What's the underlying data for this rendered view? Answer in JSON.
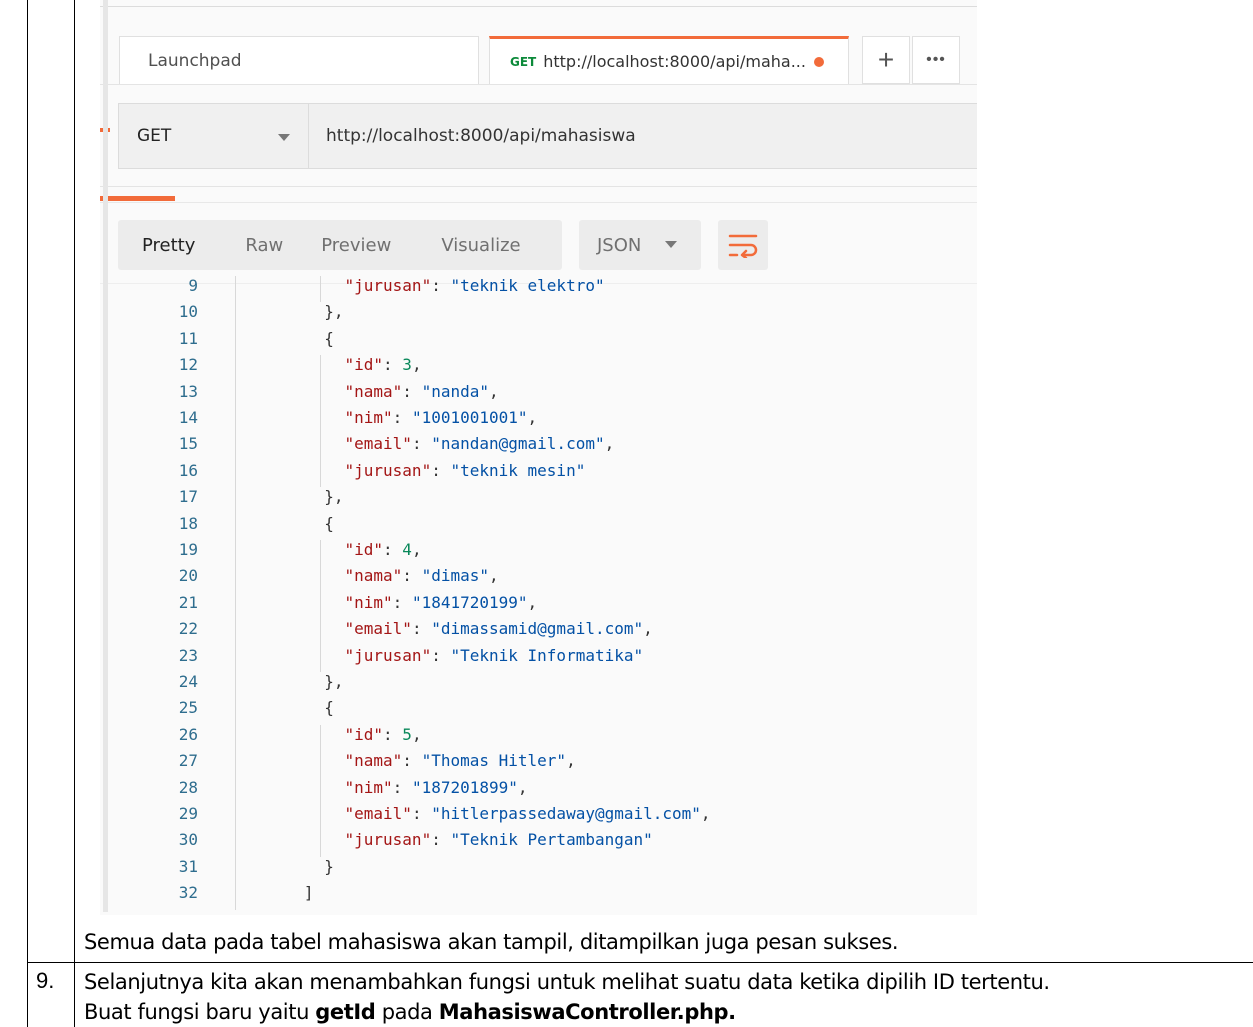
{
  "tabs": {
    "launchpad": "Launchpad",
    "request_method": "GET",
    "request_title": "http://localhost:8000/api/maha...",
    "plus": "+",
    "more": "•••"
  },
  "request": {
    "method": "GET",
    "url": "http://localhost:8000/api/mahasiswa"
  },
  "response_views": [
    "Pretty",
    "Raw",
    "Preview",
    "Visualize"
  ],
  "format": "JSON",
  "colors": {
    "accent": "#f26b3a",
    "get_method": "#0c8a3a",
    "json_key": "#a31515",
    "json_string": "#0451a5",
    "json_number": "#09885a",
    "line_number": "#2e6d8e"
  },
  "code_lines": [
    {
      "n": "9",
      "indent": 5,
      "key": "\"jurusan\"",
      "sep": ": ",
      "val": "\"teknik elektro\"",
      "type": "s",
      "tail": ""
    },
    {
      "n": "10",
      "indent": 4,
      "raw": "},"
    },
    {
      "n": "11",
      "indent": 4,
      "raw": "{"
    },
    {
      "n": "12",
      "indent": 5,
      "key": "\"id\"",
      "sep": ": ",
      "val": "3",
      "type": "n",
      "tail": ","
    },
    {
      "n": "13",
      "indent": 5,
      "key": "\"nama\"",
      "sep": ": ",
      "val": "\"nanda\"",
      "type": "s",
      "tail": ","
    },
    {
      "n": "14",
      "indent": 5,
      "key": "\"nim\"",
      "sep": ": ",
      "val": "\"1001001001\"",
      "type": "s",
      "tail": ","
    },
    {
      "n": "15",
      "indent": 5,
      "key": "\"email\"",
      "sep": ": ",
      "val": "\"nandan@gmail.com\"",
      "type": "s",
      "tail": ","
    },
    {
      "n": "16",
      "indent": 5,
      "key": "\"jurusan\"",
      "sep": ": ",
      "val": "\"teknik mesin\"",
      "type": "s",
      "tail": ""
    },
    {
      "n": "17",
      "indent": 4,
      "raw": "},"
    },
    {
      "n": "18",
      "indent": 4,
      "raw": "{"
    },
    {
      "n": "19",
      "indent": 5,
      "key": "\"id\"",
      "sep": ": ",
      "val": "4",
      "type": "n",
      "tail": ","
    },
    {
      "n": "20",
      "indent": 5,
      "key": "\"nama\"",
      "sep": ": ",
      "val": "\"dimas\"",
      "type": "s",
      "tail": ","
    },
    {
      "n": "21",
      "indent": 5,
      "key": "\"nim\"",
      "sep": ": ",
      "val": "\"1841720199\"",
      "type": "s",
      "tail": ","
    },
    {
      "n": "22",
      "indent": 5,
      "key": "\"email\"",
      "sep": ": ",
      "val": "\"dimassamid@gmail.com\"",
      "type": "s",
      "tail": ","
    },
    {
      "n": "23",
      "indent": 5,
      "key": "\"jurusan\"",
      "sep": ": ",
      "val": "\"Teknik Informatika\"",
      "type": "s",
      "tail": ""
    },
    {
      "n": "24",
      "indent": 4,
      "raw": "},"
    },
    {
      "n": "25",
      "indent": 4,
      "raw": "{"
    },
    {
      "n": "26",
      "indent": 5,
      "key": "\"id\"",
      "sep": ": ",
      "val": "5",
      "type": "n",
      "tail": ","
    },
    {
      "n": "27",
      "indent": 5,
      "key": "\"nama\"",
      "sep": ": ",
      "val": "\"Thomas Hitler\"",
      "type": "s",
      "tail": ","
    },
    {
      "n": "28",
      "indent": 5,
      "key": "\"nim\"",
      "sep": ": ",
      "val": "\"187201899\"",
      "type": "s",
      "tail": ","
    },
    {
      "n": "29",
      "indent": 5,
      "key": "\"email\"",
      "sep": ": ",
      "val": "\"hitlerpassedaway@gmail.com\"",
      "type": "s",
      "tail": ","
    },
    {
      "n": "30",
      "indent": 5,
      "key": "\"jurusan\"",
      "sep": ": ",
      "val": "\"Teknik Pertambangan\"",
      "type": "s",
      "tail": ""
    },
    {
      "n": "31",
      "indent": 4,
      "raw": "}"
    },
    {
      "n": "32",
      "indent": 3,
      "raw": "]"
    }
  ],
  "document": {
    "caption": "Semua data pada tabel mahasiswa akan tampil, ditampilkan juga pesan sukses.",
    "step_number": "9.",
    "line1": "Selanjutnya kita akan menambahkan fungsi untuk melihat suatu data ketika dipilih ID tertentu.",
    "line2_prefix": "Buat fungsi baru yaitu ",
    "line2_bold1": "getId",
    "line2_mid": " pada ",
    "line2_bold2": "MahasiswaController.php."
  }
}
